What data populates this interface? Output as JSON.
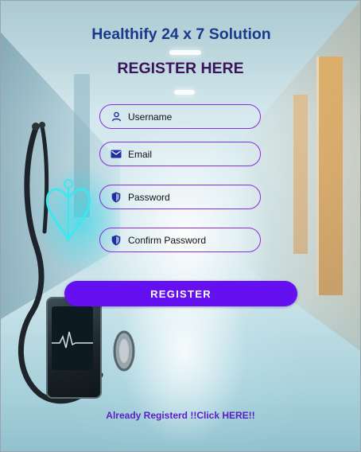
{
  "app": {
    "title": "Healthify 24 x 7 Solution"
  },
  "form": {
    "heading": "REGISTER HERE",
    "fields": [
      {
        "placeholder": "Username",
        "value": "",
        "icon": "person-icon"
      },
      {
        "placeholder": "Email",
        "value": "",
        "icon": "envelope-icon"
      },
      {
        "placeholder": "Password",
        "value": "",
        "icon": "shield-icon"
      },
      {
        "placeholder": "Confirm Password",
        "value": "",
        "icon": "shield-icon"
      }
    ],
    "submit_label": "REGISTER",
    "login_link_label": "Already Registerd !!Click HERE!!"
  },
  "colors": {
    "title": "#1b3a8c",
    "heading": "#3a1358",
    "field_border": "#8a2be2",
    "button": "#6410f0",
    "link": "#5a1ec8",
    "icon": "#1e2fa0"
  }
}
